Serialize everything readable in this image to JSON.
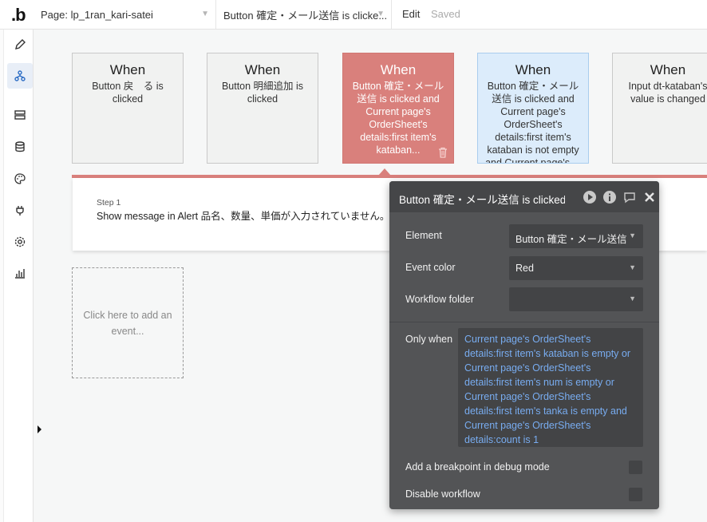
{
  "topbar": {
    "logo": "b",
    "page_selector": "Page: lp_1ran_kari-satei",
    "event_selector": "Button 確定・メール送信 is clicke...",
    "edit_label": "Edit",
    "saved_label": "Saved"
  },
  "sidebar": {
    "items": [
      "design",
      "workflow",
      "data",
      "database",
      "styles",
      "plugins",
      "settings",
      "logs"
    ],
    "active": "workflow"
  },
  "events": [
    {
      "when": "When",
      "description": "Button 戻　る is clicked",
      "color": "default"
    },
    {
      "when": "When",
      "description": "Button 明細追加 is clicked",
      "color": "default"
    },
    {
      "when": "When",
      "description": "Button 確定・メール送信 is clicked and Current page's OrderSheet's details:first item's kataban...",
      "color": "red"
    },
    {
      "when": "When",
      "description": "Button 確定・メール送信 is clicked and Current page's OrderSheet's details:first item's kataban is not empty and Current page's ...",
      "color": "blue"
    },
    {
      "when": "When",
      "description": "Input dt-kataban's value is changed",
      "color": "default"
    }
  ],
  "step": {
    "label": "Step 1",
    "action": "Show message in Alert 品名、数量、単価が入力されていません。"
  },
  "add_event": {
    "text": "Click here to add an event..."
  },
  "panel": {
    "title": "Button 確定・メール送信 is clicked",
    "element_label": "Element",
    "element_value": "Button 確定・メール送信",
    "event_color_label": "Event color",
    "event_color_value": "Red",
    "workflow_folder_label": "Workflow folder",
    "workflow_folder_value": "",
    "only_when_label": "Only when",
    "only_when_value": "Current page's OrderSheet's details:first item's kataban is empty or Current page's OrderSheet's details:first item's num is empty or Current page's OrderSheet's details:first item's tanka is empty and Current page's OrderSheet's details:count is 1",
    "breakpoint_label": "Add a breakpoint in debug mode",
    "breakpoint_checked": false,
    "disable_label": "Disable workflow",
    "disable_checked": false
  },
  "colors": {
    "red_event": "#d9807c",
    "blue_event": "#dcecfb",
    "panel_bg": "#535456",
    "condition_text": "#78acf0"
  }
}
